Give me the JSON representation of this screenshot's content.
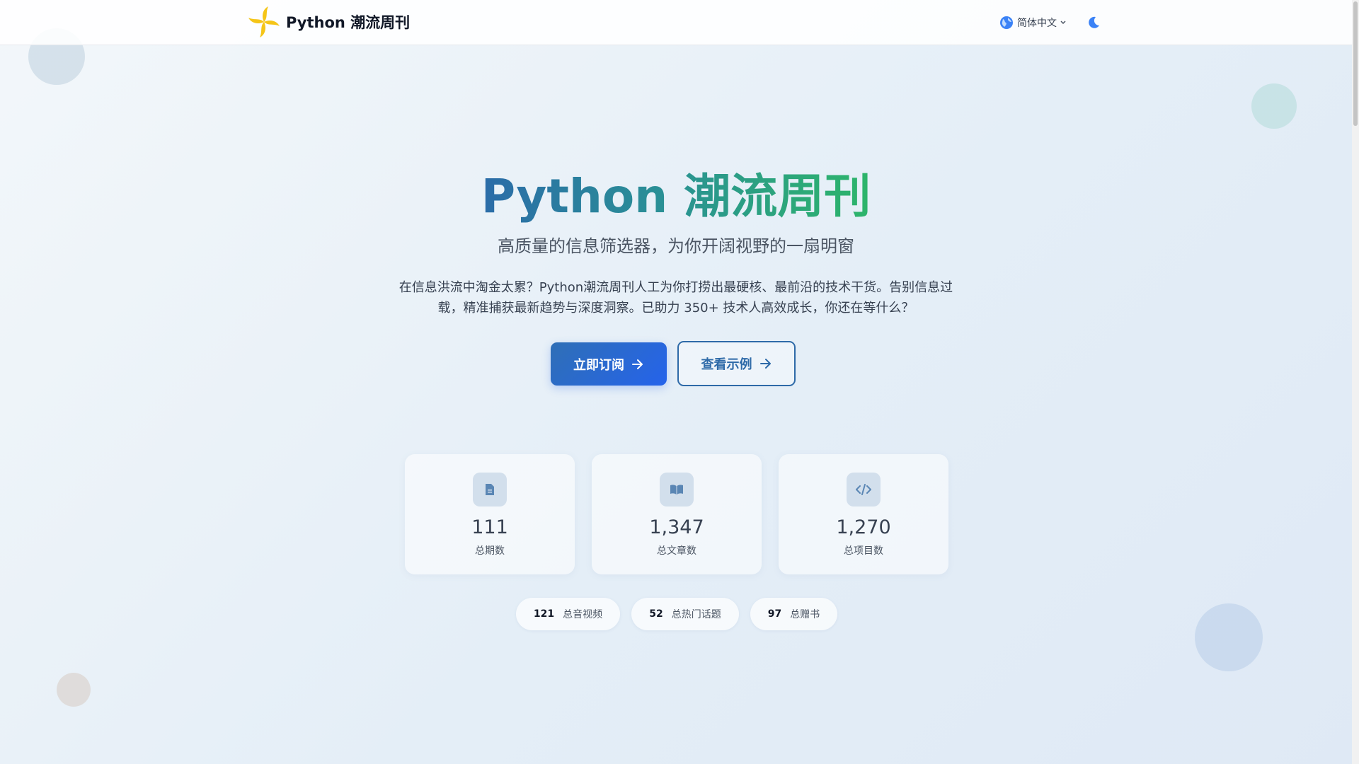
{
  "header": {
    "brand_name": "Python 潮流周刊",
    "language": "简体中文"
  },
  "hero": {
    "title_prefix": "Python ",
    "title_highlight": "潮流周刊",
    "subtitle": "高质量的信息筛选器，为你开阔视野的一扇明窗",
    "description": "在信息洪流中淘金太累？Python潮流周刊人工为你打捞出最硬核、最前沿的技术干货。告别信息过载，精准捕获最新趋势与深度洞察。已助力 350+ 技术人高效成长，你还在等什么？",
    "primary_button": "立即订阅",
    "secondary_button": "查看示例"
  },
  "stats": [
    {
      "value": "111",
      "label": "总期数",
      "icon": "document-icon"
    },
    {
      "value": "1,347",
      "label": "总文章数",
      "icon": "book-icon"
    },
    {
      "value": "1,270",
      "label": "总项目数",
      "icon": "code-icon"
    }
  ],
  "pills": [
    {
      "value": "121",
      "label": "总音视频"
    },
    {
      "value": "52",
      "label": "总热门话题"
    },
    {
      "value": "97",
      "label": "总赠书"
    }
  ],
  "colors": {
    "accent_blue": "#2b6ca8",
    "accent_green": "#2db56a",
    "primary_button": "#2563eb",
    "logo_yellow": "#f5c518"
  }
}
